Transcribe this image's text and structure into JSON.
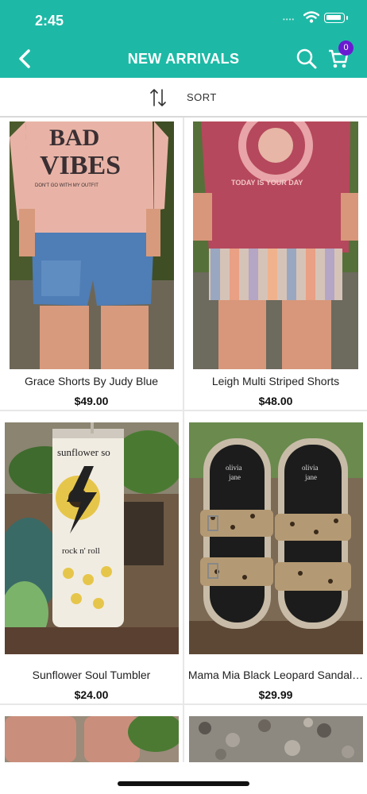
{
  "status": {
    "time": "2:45",
    "signal": "••••",
    "cart_count": "0"
  },
  "header": {
    "title": "NEW ARRIVALS"
  },
  "sort": {
    "label": "SORT"
  },
  "products": [
    {
      "name": "Grace Shorts By Judy Blue",
      "price": "$49.00"
    },
    {
      "name": "Leigh Multi Striped Shorts",
      "price": "$48.00"
    },
    {
      "name": "Sunflower Soul Tumbler",
      "price": "$24.00"
    },
    {
      "name": "Mama Mia Black Leopard Sandal…",
      "price": "$29.99"
    }
  ],
  "image_text": {
    "p1": {
      "line1": "BAD",
      "line2": "VIBES",
      "line3": "DON'T GO WITH MY OUTFIT"
    },
    "p2": {
      "arc": "TODAY IS YOUR DAY"
    },
    "p3": {
      "line1": "sunflower so",
      "line2": "rock n' roll"
    },
    "p4": {
      "brand1": "olivia",
      "brand2": "jane"
    }
  },
  "colors": {
    "header": "#1db9a6",
    "badge": "#6a1bd1"
  }
}
